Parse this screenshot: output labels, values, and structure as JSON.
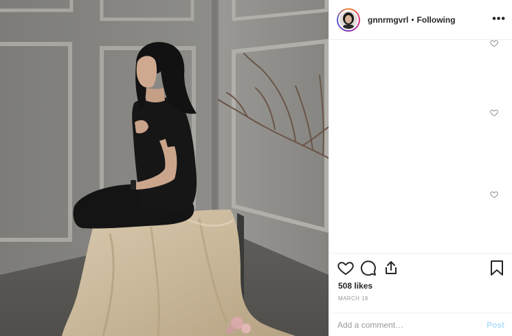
{
  "post": {
    "author": {
      "username": "gnnrmgvrl",
      "separator": "•",
      "follow_status": "Following"
    },
    "more_label": "•••",
    "comment_like_icon": "heart-outline-icon",
    "actions": {
      "like_icon": "heart-outline-icon",
      "comment_icon": "comment-bubble-icon",
      "share_icon": "share-upload-icon",
      "save_icon": "bookmark-icon"
    },
    "likes_text": "508 likes",
    "date_text": "MARCH 19",
    "comment_input": {
      "placeholder": "Add a comment…",
      "value": ""
    },
    "post_button_label": "Post",
    "colors": {
      "post_button_disabled": "#b2dffc",
      "divider": "#efefef",
      "muted_text": "#999999"
    }
  }
}
